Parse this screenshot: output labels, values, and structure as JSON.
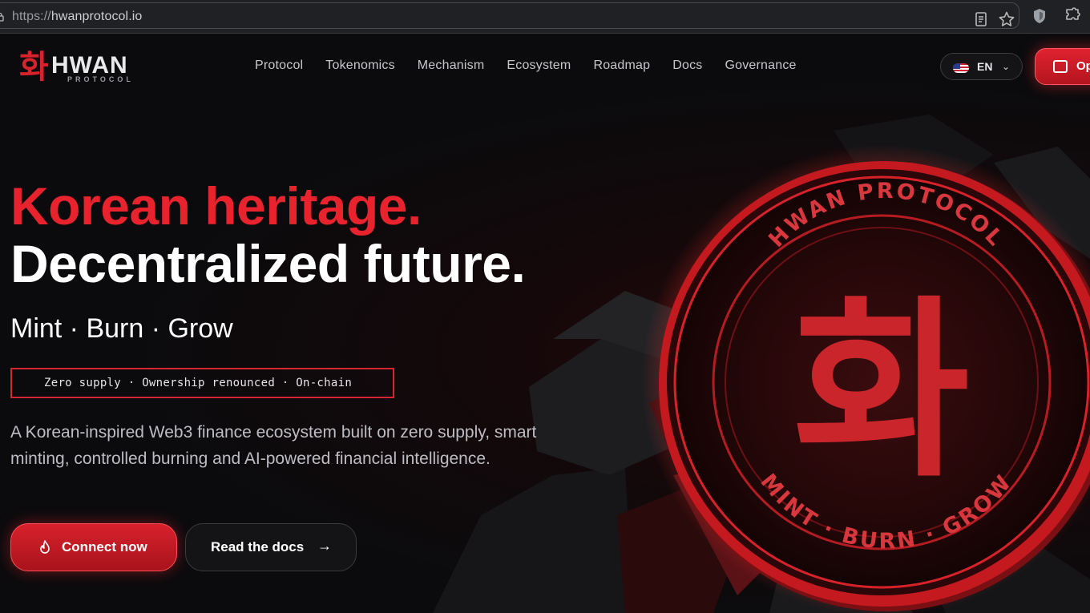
{
  "browser": {
    "url_scheme": "https://",
    "url_host": "hwanprotocol.io"
  },
  "header": {
    "logo_main": "HWAN",
    "logo_sub": "PROTOCOL",
    "logo_glyph": "화",
    "nav": [
      "Protocol",
      "Tokenomics",
      "Mechanism",
      "Ecosystem",
      "Roadmap",
      "Docs",
      "Governance"
    ],
    "language": "EN",
    "open_button_label": "Op"
  },
  "hero": {
    "headline_line1": "Korean heritage.",
    "headline_line2": "Decentralized future.",
    "tagline": "Mint · Burn · Grow",
    "chip": "Zero supply · Ownership renounced · On-chain",
    "description": "A Korean-inspired Web3 finance ecosystem built on zero supply, smart minting, controlled burning and AI-powered financial intelligence.",
    "connect_button": "Connect now",
    "docs_button": "Read the docs"
  },
  "coin": {
    "top_text": "HWAN PROTOCOL",
    "glyph": "화",
    "bottom_text": "MINT · BURN · GROW"
  },
  "colors": {
    "accent": "#e8232e",
    "background": "#0b0b0d"
  }
}
